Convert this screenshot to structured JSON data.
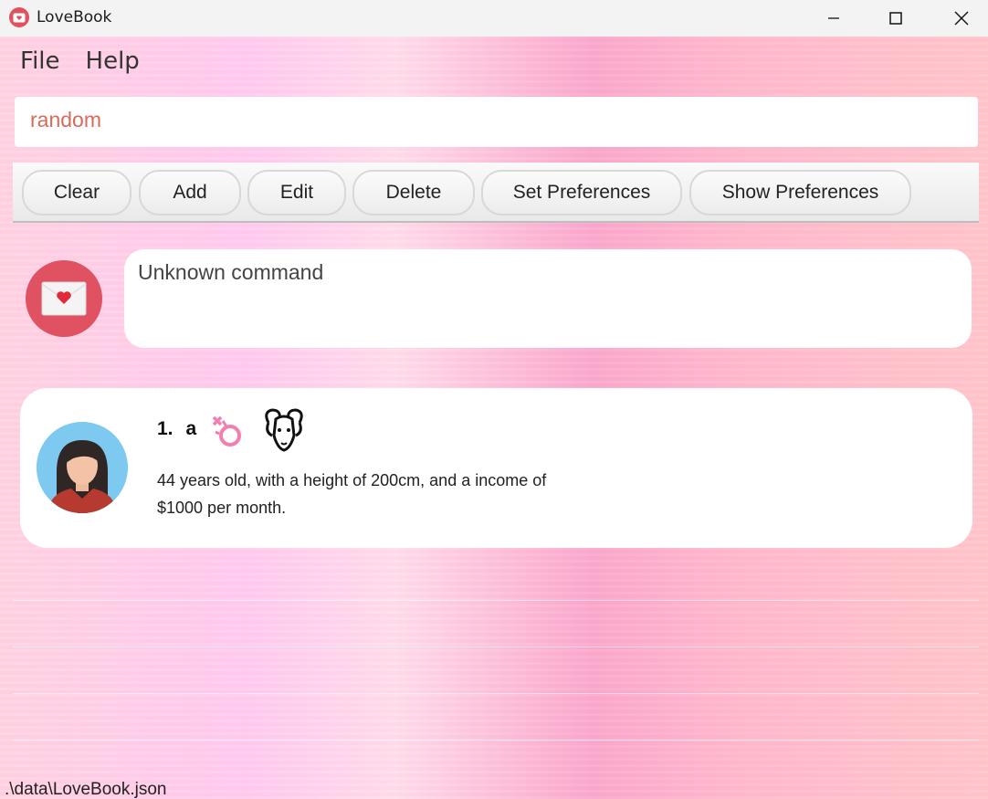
{
  "window": {
    "title": "LoveBook",
    "minimize_glyph": "—",
    "close_glyph": "✕"
  },
  "menu": {
    "items": [
      "File",
      "Help"
    ]
  },
  "command": {
    "value": "random"
  },
  "toolbar": {
    "buttons": [
      "Clear",
      "Add",
      "Edit",
      "Delete",
      "Set Preferences",
      "Show Preferences"
    ]
  },
  "result": {
    "message": "Unknown command",
    "icon": "love-letter-icon"
  },
  "people": [
    {
      "index": "1.",
      "name": "a",
      "gender_icon": "gender-symbol-icon",
      "zodiac_icon": "aries-ram-icon",
      "description": "44 years old, with a height of 200cm, and a income of $1000 per month."
    }
  ],
  "status": {
    "path": ".\\data\\LoveBook.json"
  },
  "colors": {
    "accent": "#e05162",
    "command_text": "#d96a5a",
    "avatar_bg": "#7dc9ef"
  }
}
